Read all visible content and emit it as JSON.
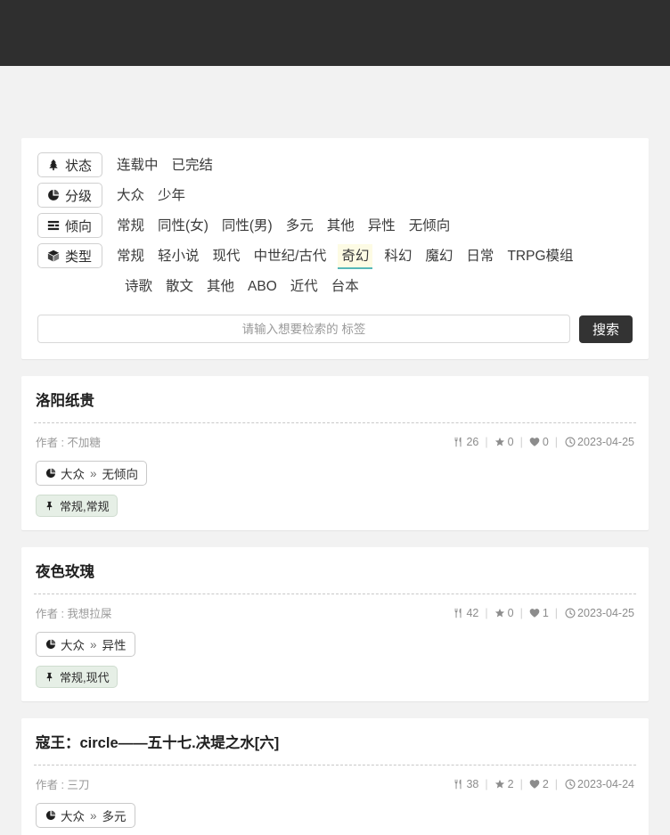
{
  "header": {
    "background": "#2f2f2f"
  },
  "theme": {
    "page_background": "#f2f2f2",
    "card_background": "#ffffff",
    "accent_highlight_bg": "#fdfbe4",
    "accent_underline": "#56b8b8",
    "tag_badge_bg": "#e6efe6",
    "button_dark": "#333333"
  },
  "filters": {
    "rows": [
      {
        "label": "状态",
        "icon": "tree-icon",
        "options": [
          {
            "label": "连载中",
            "active": false
          },
          {
            "label": "已完结",
            "active": false
          }
        ]
      },
      {
        "label": "分级",
        "icon": "pie-chart-icon",
        "options": [
          {
            "label": "大众",
            "active": false
          },
          {
            "label": "少年",
            "active": false
          }
        ]
      },
      {
        "label": "倾向",
        "icon": "list-bars-icon",
        "options": [
          {
            "label": "常规",
            "active": false
          },
          {
            "label": "同性(女)",
            "active": false
          },
          {
            "label": "同性(男)",
            "active": false
          },
          {
            "label": "多元",
            "active": false
          },
          {
            "label": "其他",
            "active": false
          },
          {
            "label": "异性",
            "active": false
          },
          {
            "label": "无倾向",
            "active": false
          }
        ]
      },
      {
        "label": "类型",
        "icon": "cube-icon",
        "options": [
          {
            "label": "常规",
            "active": false
          },
          {
            "label": "轻小说",
            "active": false
          },
          {
            "label": "现代",
            "active": false
          },
          {
            "label": "中世纪/古代",
            "active": false
          },
          {
            "label": "奇幻",
            "active": true
          },
          {
            "label": "科幻",
            "active": false
          },
          {
            "label": "魔幻",
            "active": false
          },
          {
            "label": "日常",
            "active": false
          },
          {
            "label": "TRPG模组",
            "active": false
          }
        ]
      },
      {
        "label": "",
        "icon": "",
        "continuation": true,
        "options": [
          {
            "label": "诗歌",
            "active": false
          },
          {
            "label": "散文",
            "active": false
          },
          {
            "label": "其他",
            "active": false
          },
          {
            "label": "ABO",
            "active": false
          },
          {
            "label": "近代",
            "active": false
          },
          {
            "label": "台本",
            "active": false
          }
        ]
      }
    ]
  },
  "search": {
    "placeholder": "请输入想要检索的 标签",
    "value": "",
    "button_label": "搜索"
  },
  "stat_icons": {
    "views": "fork-knife-icon",
    "stars": "star-icon",
    "likes": "heart-icon",
    "date": "clock-icon"
  },
  "results": [
    {
      "title": "洛阳纸贵",
      "author_prefix": "作者 :",
      "author": "不加糖",
      "views": "26",
      "stars": "0",
      "likes": "0",
      "date": "2023-04-25",
      "category_badge": {
        "icon": "pie-chart-icon",
        "left": "大众",
        "arrow": "»",
        "right": "无倾向"
      },
      "tag_badge": {
        "icon": "pin-icon",
        "label": "常规,常规"
      }
    },
    {
      "title": "夜色玫瑰",
      "author_prefix": "作者 :",
      "author": "我想拉屎",
      "views": "42",
      "stars": "0",
      "likes": "1",
      "date": "2023-04-25",
      "category_badge": {
        "icon": "pie-chart-icon",
        "left": "大众",
        "arrow": "»",
        "right": "异性"
      },
      "tag_badge": {
        "icon": "pin-icon",
        "label": "常规,现代"
      }
    },
    {
      "title": "寇王：circle——五十七.决堤之水[六]",
      "author_prefix": "作者 :",
      "author": "三刀",
      "views": "38",
      "stars": "2",
      "likes": "2",
      "date": "2023-04-24",
      "category_badge": {
        "icon": "pie-chart-icon",
        "left": "大众",
        "arrow": "»",
        "right": "多元"
      },
      "tag_badge": null
    }
  ]
}
